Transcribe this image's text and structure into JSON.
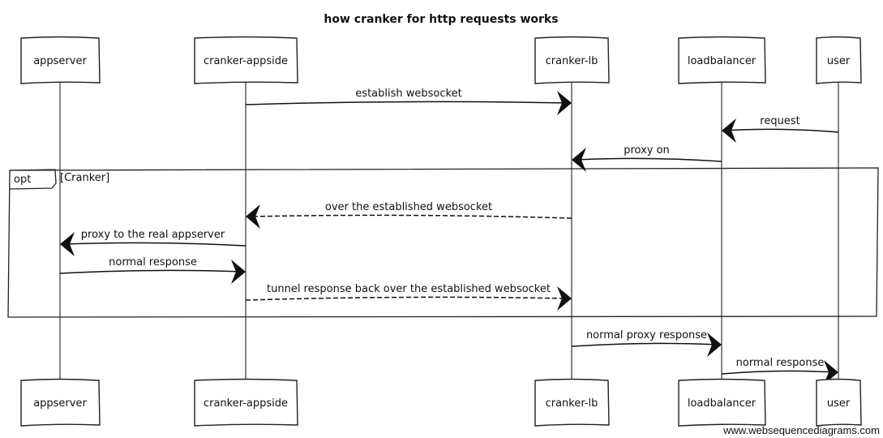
{
  "title": "how cranker for http requests works",
  "participants": [
    {
      "id": "appserver",
      "label": "appserver"
    },
    {
      "id": "cranker-appside",
      "label": "cranker-appside"
    },
    {
      "id": "cranker-lb",
      "label": "cranker-lb"
    },
    {
      "id": "loadbalancer",
      "label": "loadbalancer"
    },
    {
      "id": "user",
      "label": "user"
    }
  ],
  "messages": [
    {
      "from": "cranker-appside",
      "to": "cranker-lb",
      "label": "establish websocket",
      "style": "solid"
    },
    {
      "from": "user",
      "to": "loadbalancer",
      "label": "request",
      "style": "solid"
    },
    {
      "from": "loadbalancer",
      "to": "cranker-lb",
      "label": "proxy on",
      "style": "solid"
    },
    {
      "from": "cranker-lb",
      "to": "cranker-appside",
      "label": "over the established websocket",
      "style": "dashed"
    },
    {
      "from": "cranker-appside",
      "to": "appserver",
      "label": "proxy to the real appserver",
      "style": "solid"
    },
    {
      "from": "appserver",
      "to": "cranker-appside",
      "label": "normal response",
      "style": "solid"
    },
    {
      "from": "cranker-appside",
      "to": "cranker-lb",
      "label": "tunnel response back over the established websocket",
      "style": "dashed"
    },
    {
      "from": "cranker-lb",
      "to": "loadbalancer",
      "label": "normal proxy response",
      "style": "solid"
    },
    {
      "from": "loadbalancer",
      "to": "user",
      "label": "normal response",
      "style": "solid"
    }
  ],
  "fragment": {
    "keyword": "opt",
    "condition": "[Cranker]",
    "first_message": 3,
    "last_message": 6
  },
  "watermark": "www.websequencediagrams.com"
}
